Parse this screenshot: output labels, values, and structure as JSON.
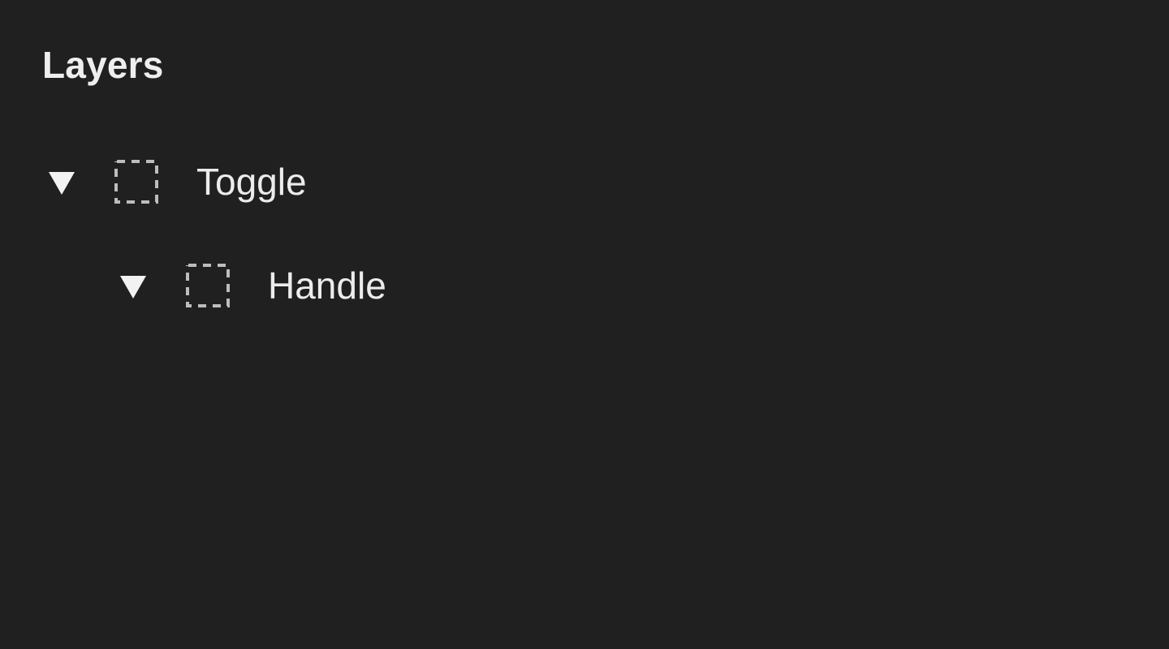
{
  "panel": {
    "title": "Layers"
  },
  "layers": [
    {
      "label": "Toggle",
      "expanded": true,
      "depth": 0,
      "disclosure_icon": "triangle-down-icon",
      "type_icon": "frame-icon"
    },
    {
      "label": "Handle",
      "expanded": true,
      "depth": 1,
      "disclosure_icon": "triangle-down-icon",
      "type_icon": "frame-icon"
    }
  ],
  "colors": {
    "background": "#202020",
    "text": "#ececec",
    "icon_dashed": "#bdbdbd",
    "disclosure": "#f2f2f2"
  }
}
